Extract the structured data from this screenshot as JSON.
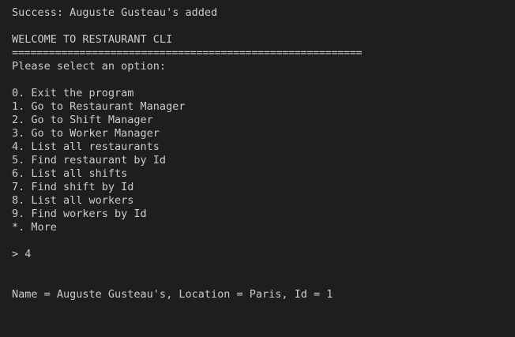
{
  "terminal": {
    "status_message": "Success: Auguste Gusteau's added",
    "title": "WELCOME TO RESTAURANT CLI",
    "separator": "=========================================================",
    "prompt_text": "Please select an option:",
    "options": [
      "0. Exit the program",
      "1. Go to Restaurant Manager",
      "2. Go to Shift Manager",
      "3. Go to Worker Manager",
      "4. List all restaurants",
      "5. Find restaurant by Id",
      "6. List all shifts",
      "7. Find shift by Id",
      "8. List all workers",
      "9. Find workers by Id",
      "*. More"
    ],
    "input_line": "> 4",
    "result_line": "Name = Auguste Gusteau's, Location = Paris, Id = 1"
  },
  "colors": {
    "background": "#1e1e1e",
    "text": "#cccccc"
  }
}
